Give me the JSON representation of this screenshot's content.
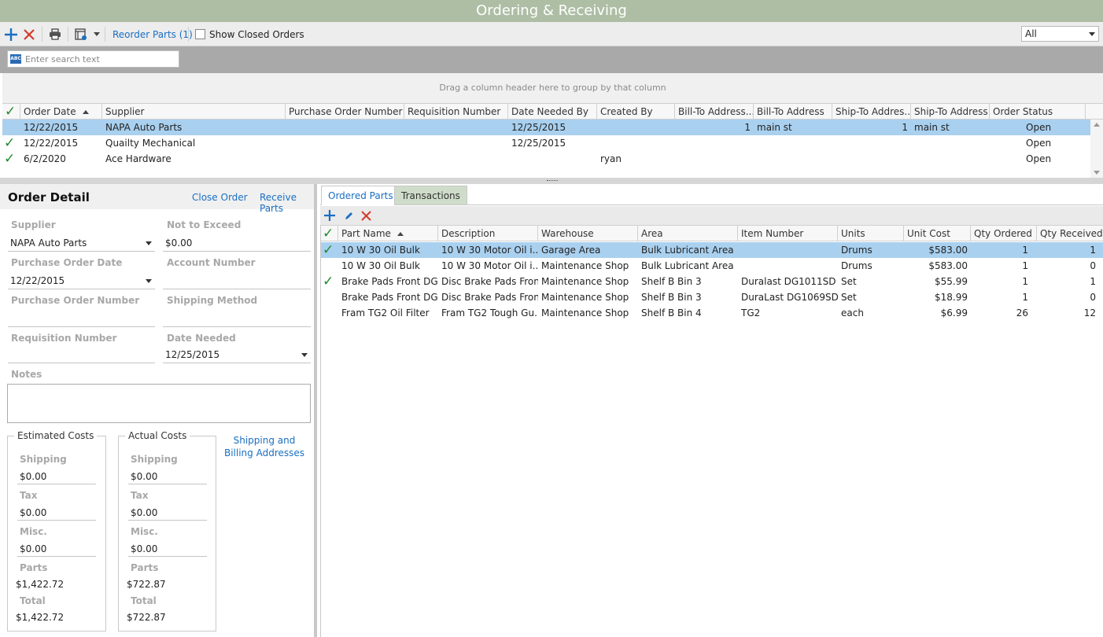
{
  "window": {
    "title": "Ordering & Receiving"
  },
  "toolbar": {
    "reorder_label": "Reorder Parts (1)",
    "show_closed_label": "Show Closed Orders",
    "filter_value": "All"
  },
  "search": {
    "placeholder": "Enter search text",
    "icon_text": "ABC"
  },
  "grid": {
    "group_hint": "Drag a column header here to group by that column",
    "columns": [
      "Order Date",
      "Supplier",
      "Purchase Order Number",
      "Requisition Number",
      "Date Needed By",
      "Created By",
      "Bill-To Address...",
      "Bill-To Address",
      "Ship-To Addres...",
      "Ship-To Address",
      "Order Status"
    ],
    "rows": [
      {
        "checked": false,
        "order_date": "12/22/2015",
        "supplier": "NAPA Auto Parts",
        "po": "",
        "req": "",
        "needed": "12/25/2015",
        "created_by": "",
        "bill_num": "1",
        "bill_addr": "main st",
        "ship_num": "1",
        "ship_addr": "main st",
        "status": "Open"
      },
      {
        "checked": true,
        "order_date": "12/22/2015",
        "supplier": "Quailty Mechanical",
        "po": "",
        "req": "",
        "needed": "12/25/2015",
        "created_by": "",
        "bill_num": "",
        "bill_addr": "",
        "ship_num": "",
        "ship_addr": "",
        "status": "Open"
      },
      {
        "checked": true,
        "order_date": "6/2/2020",
        "supplier": "Ace Hardware",
        "po": "",
        "req": "",
        "needed": "",
        "created_by": "ryan",
        "bill_num": "",
        "bill_addr": "",
        "ship_num": "",
        "ship_addr": "",
        "status": "Open"
      }
    ]
  },
  "order_detail": {
    "title": "Order Detail",
    "close_order": "Close Order",
    "receive_parts": "Receive Parts",
    "supplier_label": "Supplier",
    "supplier_value": "NAPA Auto Parts",
    "nte_label": "Not to Exceed",
    "nte_value": "$0.00",
    "po_date_label": "Purchase Order Date",
    "po_date_value": "12/22/2015",
    "account_label": "Account Number",
    "account_value": "",
    "po_number_label": "Purchase Order Number",
    "po_number_value": "",
    "shipping_method_label": "Shipping Method",
    "shipping_method_value": "",
    "req_label": "Requisition Number",
    "req_value": "",
    "date_needed_label": "Date Needed",
    "date_needed_value": "12/25/2015",
    "notes_label": "Notes",
    "shipping_billing_link": "Shipping and Billing Addresses"
  },
  "estimated_costs": {
    "legend": "Estimated Costs",
    "shipping_label": "Shipping",
    "shipping": "$0.00",
    "tax_label": "Tax",
    "tax": "$0.00",
    "misc_label": "Misc.",
    "misc": "$0.00",
    "parts_label": "Parts",
    "parts": "$1,422.72",
    "total_label": "Total",
    "total": "$1,422.72"
  },
  "actual_costs": {
    "legend": "Actual Costs",
    "shipping_label": "Shipping",
    "shipping": "$0.00",
    "tax_label": "Tax",
    "tax": "$0.00",
    "misc_label": "Misc.",
    "misc": "$0.00",
    "parts_label": "Parts",
    "parts": "$722.87",
    "total_label": "Total",
    "total": "$722.87"
  },
  "tabs": {
    "ordered_parts": "Ordered Parts",
    "transactions": "Transactions"
  },
  "parts": {
    "columns": [
      "Part Name",
      "Description",
      "Warehouse",
      "Area",
      "Item Number",
      "Units",
      "Unit Cost",
      "Qty Ordered",
      "Qty Received"
    ],
    "rows": [
      {
        "checked": true,
        "name": "10 W 30 Oil Bulk",
        "desc": "10 W 30 Motor Oil i...",
        "warehouse": "Garage Area",
        "area": "Bulk Lubricant Area",
        "item": "",
        "units": "Drums",
        "cost": "$583.00",
        "qty_ordered": "1",
        "qty_received": "1"
      },
      {
        "checked": false,
        "name": "10 W 30 Oil Bulk",
        "desc": "10 W 30 Motor Oil i...",
        "warehouse": "Maintenance Shop",
        "area": "Bulk Lubricant Area",
        "item": "",
        "units": "Drums",
        "cost": "$583.00",
        "qty_ordered": "1",
        "qty_received": "0"
      },
      {
        "checked": true,
        "name": "Brake Pads Front DG...",
        "desc": "Disc Brake Pads Fron...",
        "warehouse": "Maintenance Shop",
        "area": "Shelf B Bin 3",
        "item": "Duralast DG1011SD",
        "units": "Set",
        "cost": "$55.99",
        "qty_ordered": "1",
        "qty_received": "1"
      },
      {
        "checked": false,
        "name": "Brake Pads Front DG...",
        "desc": "Disc Brake Pads Fron...",
        "warehouse": "Maintenance Shop",
        "area": "Shelf B Bin 3",
        "item": "DuraLast DG1069SD",
        "units": "Set",
        "cost": "$18.99",
        "qty_ordered": "1",
        "qty_received": "0"
      },
      {
        "checked": false,
        "name": "Fram TG2 Oil Filter",
        "desc": "Fram TG2 Tough Gu...",
        "warehouse": "Maintenance Shop",
        "area": "Shelf B Bin 4",
        "item": "TG2",
        "units": "each",
        "cost": "$6.99",
        "qty_ordered": "26",
        "qty_received": "12"
      }
    ]
  },
  "colors": {
    "title_bar": "#aebea5",
    "accent": "#1a6fc2",
    "selected_row": "#a9d0ef",
    "check": "#1f8a2e",
    "delete": "#d23a2a"
  }
}
